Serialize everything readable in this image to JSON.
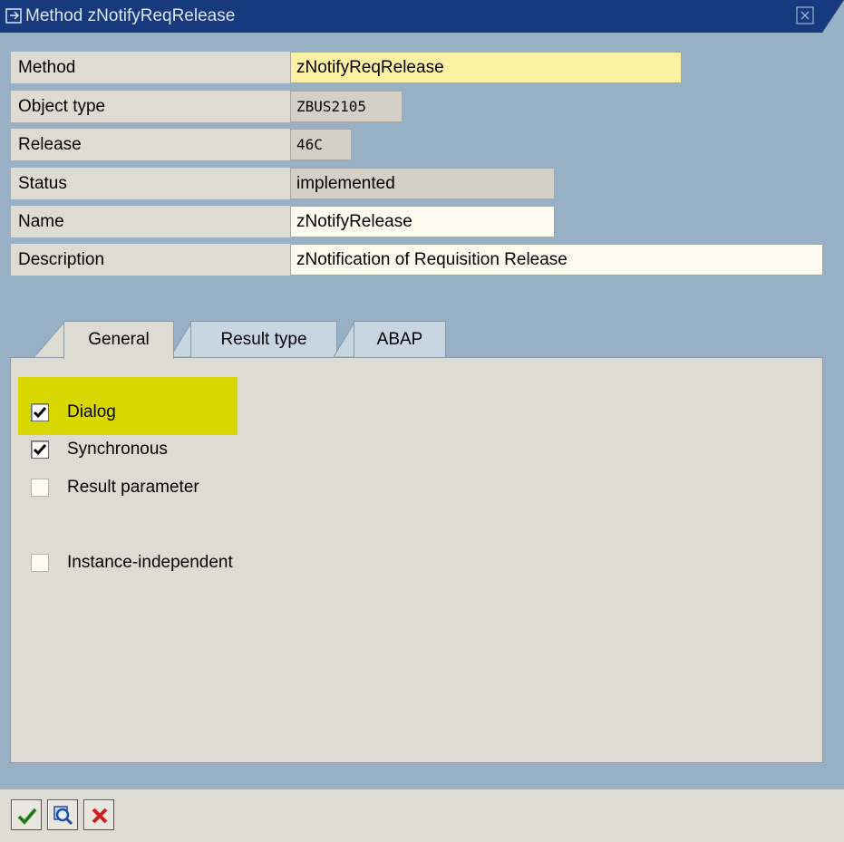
{
  "window": {
    "title": "Method zNotifyReqRelease"
  },
  "fields": [
    {
      "label": "Method",
      "value": "zNotifyReqRelease"
    },
    {
      "label": "Object type",
      "value": "ZBUS2105"
    },
    {
      "label": "Release",
      "value": "46C"
    },
    {
      "label": "Status",
      "value": "implemented"
    },
    {
      "label": "Name",
      "value": "zNotifyRelease"
    },
    {
      "label": "Description",
      "value": "zNotification of Requisition Release"
    }
  ],
  "tabs": [
    {
      "label": "General",
      "active": true
    },
    {
      "label": "Result type",
      "active": false
    },
    {
      "label": "ABAP",
      "active": false
    }
  ],
  "options": [
    {
      "label": "Dialog",
      "checked": true,
      "highlighted": true
    },
    {
      "label": "Synchronous",
      "checked": true
    },
    {
      "label": "Result parameter",
      "checked": false
    },
    {
      "label": "Instance-independent",
      "checked": false
    }
  ],
  "toolbar": {
    "buttons": [
      {
        "icon": "checkmark-icon",
        "color": "#2f8f1f"
      },
      {
        "icon": "magnifier-icon",
        "color": "#1f4fa0"
      },
      {
        "icon": "cancel-x-icon",
        "color": "#d02020"
      }
    ]
  },
  "colors": {
    "titlebar": "#173a7e",
    "background": "#98b0c6",
    "highlight": "#d8d800"
  }
}
